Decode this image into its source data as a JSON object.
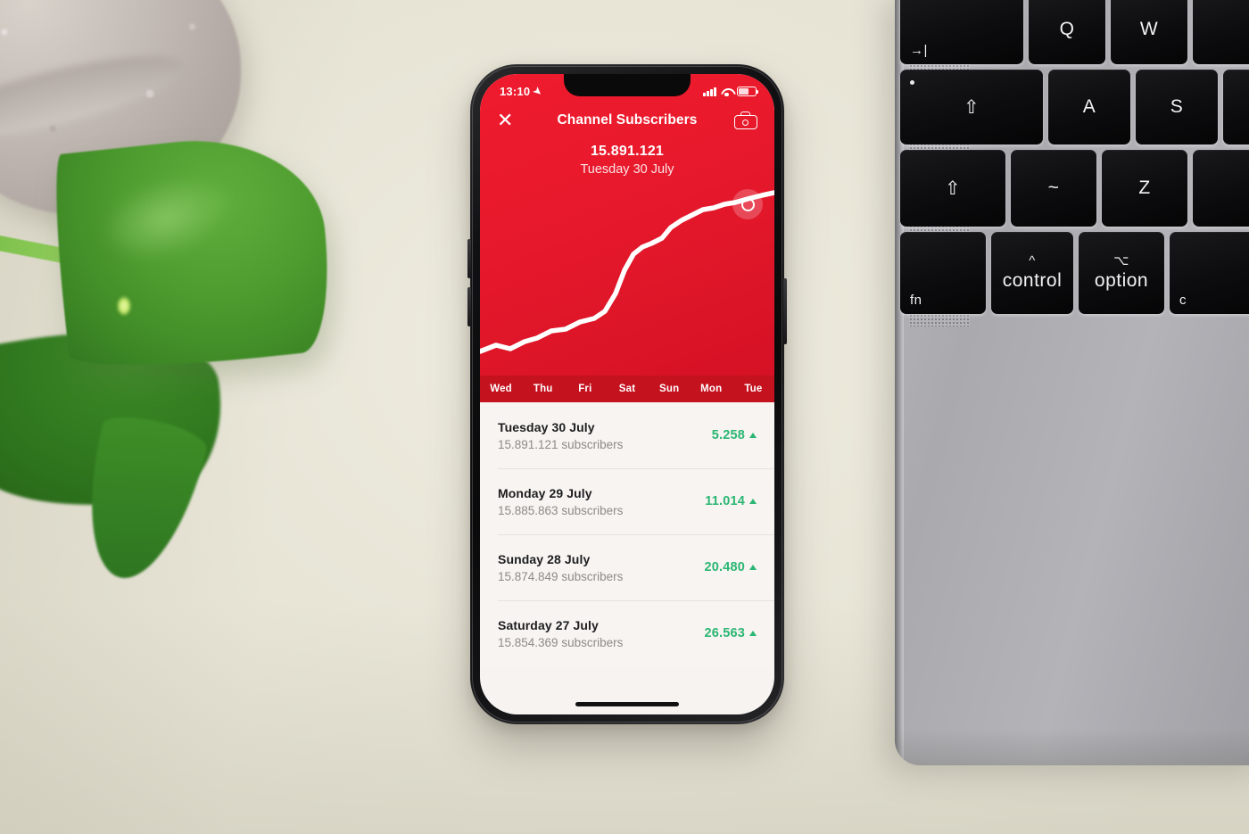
{
  "scene": {
    "background_color": "#ebe8da",
    "objects": [
      {
        "name": "potted-plant",
        "position": "top-left"
      },
      {
        "name": "laptop",
        "position": "right"
      },
      {
        "name": "smartphone",
        "position": "center"
      }
    ]
  },
  "laptop": {
    "body_color": "#a9a9ae",
    "keys": [
      {
        "name": "tab-key",
        "label": "→|"
      },
      {
        "name": "q-key",
        "label": "Q"
      },
      {
        "name": "w-key",
        "label": "W"
      },
      {
        "name": "caps-lock-key",
        "label": "⇧"
      },
      {
        "name": "a-key",
        "label": "A"
      },
      {
        "name": "s-key",
        "label": "S"
      },
      {
        "name": "shift-key",
        "label": "⇧"
      },
      {
        "name": "tilde-key",
        "label": "~"
      },
      {
        "name": "z-key",
        "label": "Z"
      },
      {
        "name": "fn-key",
        "label": "fn"
      },
      {
        "name": "control-key",
        "label": "control",
        "glyph": "^"
      },
      {
        "name": "option-key",
        "label": "option",
        "glyph": "⌥"
      },
      {
        "name": "command-key",
        "label": "c"
      }
    ]
  },
  "phone": {
    "status_bar": {
      "time": "13:10",
      "location_icon": "location-arrow-icon",
      "signal_icon": "cellular-bars-icon",
      "wifi_icon": "wifi-icon",
      "battery_icon": "battery-icon"
    },
    "nav": {
      "close_label": "✕",
      "title": "Channel Subscribers",
      "camera_icon": "camera-icon"
    },
    "hero": {
      "value": "15.891.121",
      "date": "Tuesday 30 July",
      "accent_color": "#e8192c",
      "daystrip_color": "#c4121f"
    },
    "list": {
      "rows": [
        {
          "day": "Tuesday 30 July",
          "subscribers": "15.891.121 subscribers",
          "delta": "5.258",
          "trend": "up"
        },
        {
          "day": "Monday 29 July",
          "subscribers": "15.885.863 subscribers",
          "delta": "11.014",
          "trend": "up"
        },
        {
          "day": "Sunday 28 July",
          "subscribers": "15.874.849 subscribers",
          "delta": "20.480",
          "trend": "up"
        },
        {
          "day": "Saturday 27 July",
          "subscribers": "15.854.369 subscribers",
          "delta": "26.563",
          "trend": "up"
        }
      ],
      "delta_color": "#2bb673"
    },
    "home_indicator": "home-indicator-bar"
  },
  "chart_data": {
    "type": "line",
    "title": "Channel Subscribers",
    "xlabel": "",
    "ylabel": "Subscribers",
    "categories": [
      "Wed",
      "Thu",
      "Fri",
      "Sat",
      "Sun",
      "Mon",
      "Tue"
    ],
    "tick_labels": [
      "Wed",
      "Thu",
      "Fri",
      "Sat",
      "Sun",
      "Mon",
      "Tue"
    ],
    "series": [
      {
        "name": "Subscribers",
        "values": [
          15770000,
          15800000,
          15820000,
          15854369,
          15874849,
          15885863,
          15891121
        ]
      }
    ],
    "ylim": [
      15760000,
      15900000
    ],
    "grid": false,
    "legend": false,
    "line_color": "#ffffff",
    "background_color": "#e8192c",
    "highlight_point": {
      "x": "Tue",
      "y": 15891121,
      "label": "15.891.121"
    },
    "path_points": [
      [
        0,
        183
      ],
      [
        18,
        176
      ],
      [
        34,
        180
      ],
      [
        50,
        172
      ],
      [
        64,
        168
      ],
      [
        80,
        160
      ],
      [
        96,
        158
      ],
      [
        112,
        150
      ],
      [
        128,
        146
      ],
      [
        140,
        138
      ],
      [
        152,
        118
      ],
      [
        162,
        92
      ],
      [
        172,
        74
      ],
      [
        182,
        66
      ],
      [
        192,
        62
      ],
      [
        204,
        56
      ],
      [
        214,
        44
      ],
      [
        226,
        36
      ],
      [
        238,
        30
      ],
      [
        250,
        24
      ],
      [
        262,
        22
      ],
      [
        274,
        18
      ],
      [
        286,
        16
      ],
      [
        300,
        12
      ],
      [
        316,
        8
      ],
      [
        330,
        5
      ]
    ]
  }
}
